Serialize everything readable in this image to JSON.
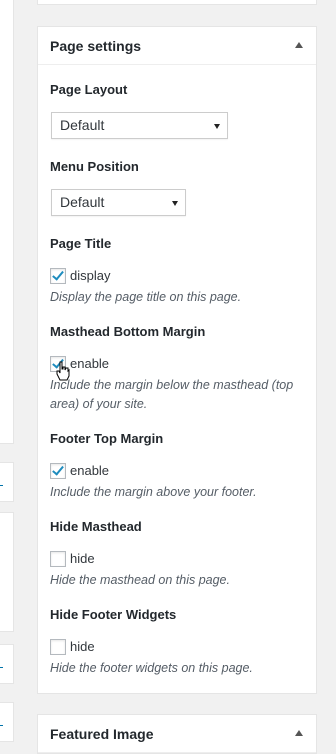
{
  "page_settings": {
    "title": "Page settings",
    "page_layout": {
      "label": "Page Layout",
      "value": "Default"
    },
    "menu_position": {
      "label": "Menu Position",
      "value": "Default"
    },
    "page_title": {
      "label": "Page Title",
      "checkbox_label": "display",
      "checked": true,
      "description": "Display the page title on this page."
    },
    "masthead_bottom_margin": {
      "label": "Masthead Bottom Margin",
      "checkbox_label": "enable",
      "checked": true,
      "description": "Include the margin below the masthead (top area) of your site."
    },
    "footer_top_margin": {
      "label": "Footer Top Margin",
      "checkbox_label": "enable",
      "checked": true,
      "description": "Include the margin above your footer."
    },
    "hide_masthead": {
      "label": "Hide Masthead",
      "checkbox_label": "hide",
      "checked": false,
      "description": "Hide the masthead on this page."
    },
    "hide_footer_widgets": {
      "label": "Hide Footer Widgets",
      "checkbox_label": "hide",
      "checked": false,
      "description": "Hide the footer widgets on this page."
    }
  },
  "featured_image": {
    "title": "Featured Image"
  },
  "icons": {
    "collapse": "triangle-up-icon",
    "cursor": "hand-pointer-icon"
  },
  "colors": {
    "accent": "#1e8cbe",
    "link": "#0073aa"
  }
}
